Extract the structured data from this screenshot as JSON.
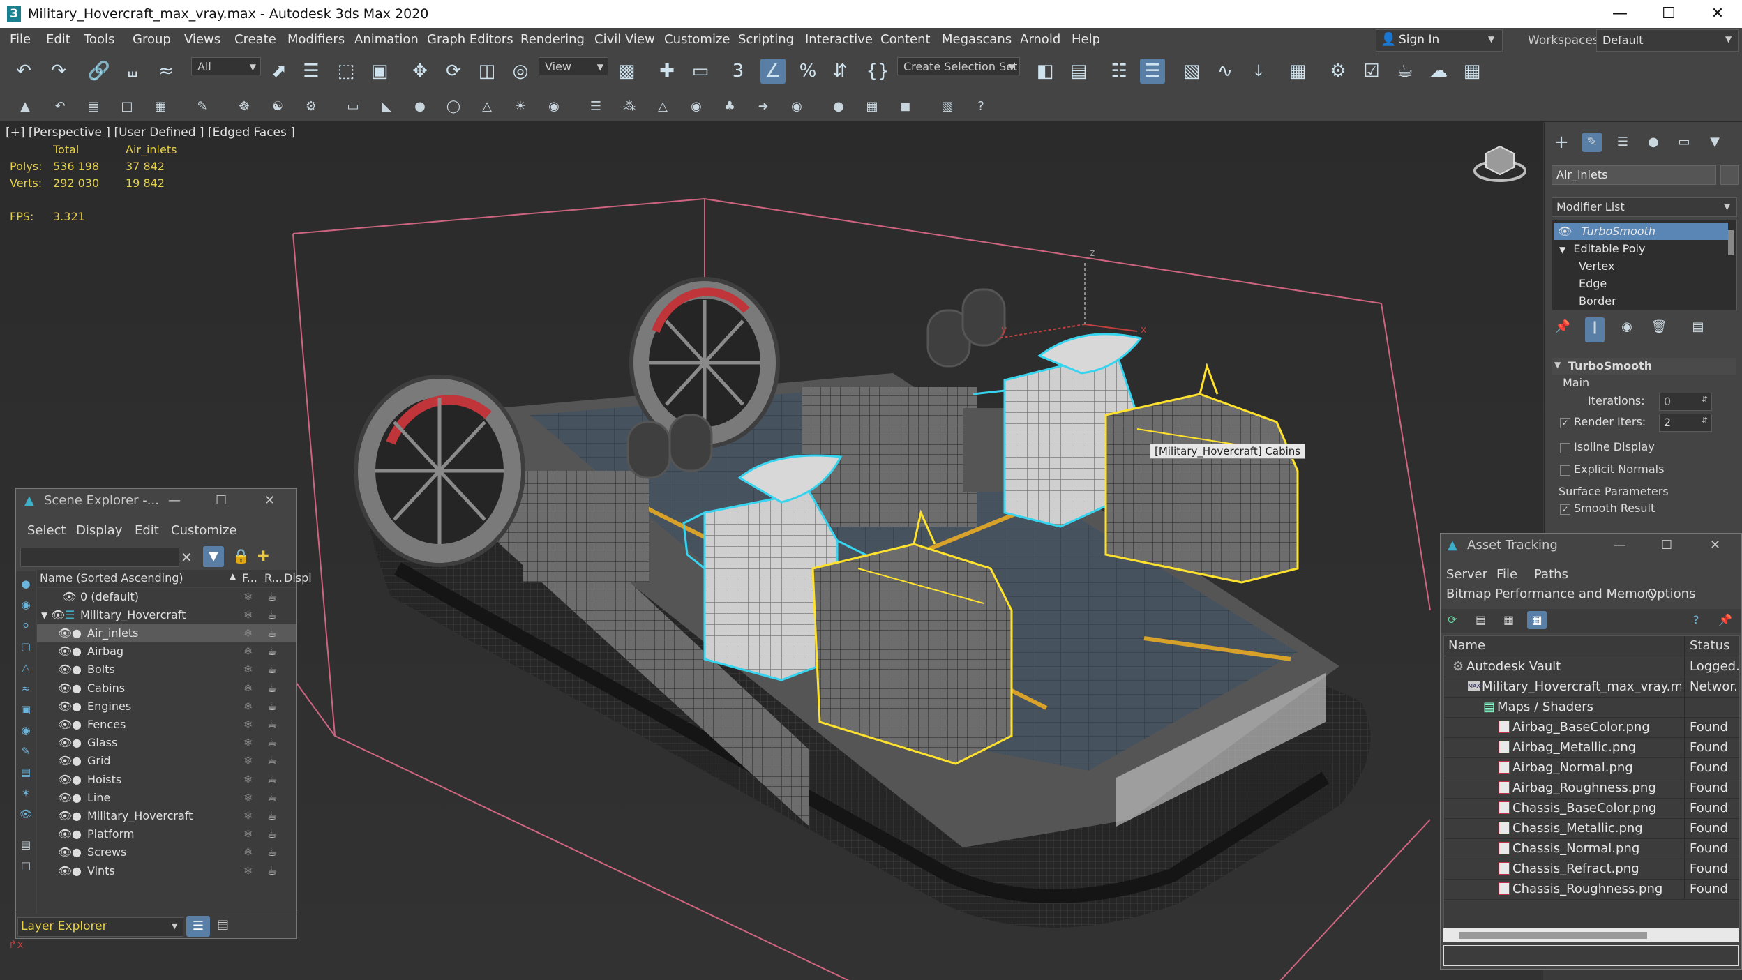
{
  "window": {
    "title": "Military_Hovercraft_max_vray.max - Autodesk 3ds Max 2020",
    "logo_glyph": "3",
    "minimize_glyph": "—",
    "maximize_glyph": "☐",
    "close_glyph": "✕"
  },
  "menu": [
    "File",
    "Edit",
    "Tools",
    "Group",
    "Views",
    "Create",
    "Modifiers",
    "Animation",
    "Graph Editors",
    "Rendering",
    "Civil View",
    "Customize",
    "Scripting",
    "Interactive",
    "Content",
    "Megascans",
    "Arnold",
    "Help"
  ],
  "account": {
    "sign_in": "Sign In",
    "workspaces_label": "Workspaces:",
    "workspace_value": "Default"
  },
  "toolbar": {
    "filter_value": "All",
    "refcoord_value": "View",
    "selection_set_placeholder": "Create Selection Set"
  },
  "viewport": {
    "label": "[+] [Perspective ] [User Defined ] [Edged Faces ]",
    "stats": {
      "header_total": "Total",
      "header_obj": "Air_inlets",
      "polys_label": "Polys:",
      "polys_total": "536 198",
      "polys_obj": "37 842",
      "verts_label": "Verts:",
      "verts_total": "292 030",
      "verts_obj": "19 842",
      "fps_label": "FPS:",
      "fps_value": "3.321"
    },
    "tooltip": "[Military_Hovercraft] Cabins",
    "axis_x": "x",
    "axis_y": "y",
    "axis_z": "z",
    "colors": {
      "select_cyan": "#37d4ef",
      "select_yellow": "#ffe22e",
      "bbox_pink": "#e06a8a"
    }
  },
  "command_panel": {
    "object_name": "Air_inlets",
    "modifier_list": "Modifier List",
    "stack": [
      "TurboSmooth",
      "Editable Poly",
      "Vertex",
      "Edge",
      "Border"
    ],
    "rollout_title": "TurboSmooth",
    "main_label": "Main",
    "iterations_label": "Iterations:",
    "iterations_value": "0",
    "render_iters_label": "Render Iters:",
    "render_iters_value": "2",
    "isoline_label": "Isoline Display",
    "explicit_label": "Explicit Normals",
    "surface_label": "Surface Parameters",
    "smooth_result_label": "Smooth Result"
  },
  "scene_explorer": {
    "title": "Scene Explorer -...",
    "menu": [
      "Select",
      "Display",
      "Edit",
      "Customize"
    ],
    "col_name": "Name (Sorted Ascending)",
    "col_f": "F...",
    "col_r": "R...",
    "col_disp": "Displ",
    "default_layer": "0 (default)",
    "root": "Military_Hovercraft",
    "items": [
      "Air_inlets",
      "Airbag",
      "Bolts",
      "Cabins",
      "Engines",
      "Fences",
      "Glass",
      "Grid",
      "Hoists",
      "Line",
      "Military_Hovercraft",
      "Platform",
      "Screws",
      "Vints"
    ],
    "footer": "Layer Explorer"
  },
  "asset_tracking": {
    "title": "Asset Tracking",
    "menu1": [
      "Server",
      "File",
      "Paths"
    ],
    "menu2": [
      "Bitmap Performance and Memory",
      "Options"
    ],
    "col_name": "Name",
    "col_status": "Status",
    "rows": [
      {
        "name": "Autodesk Vault",
        "status": "Logged...",
        "indent": 0
      },
      {
        "name": "Military_Hovercraft_max_vray.max",
        "status": "Networ...",
        "indent": 1
      },
      {
        "name": "Maps / Shaders",
        "status": "",
        "indent": 2
      },
      {
        "name": "Airbag_BaseColor.png",
        "status": "Found",
        "indent": 3
      },
      {
        "name": "Airbag_Metallic.png",
        "status": "Found",
        "indent": 3
      },
      {
        "name": "Airbag_Normal.png",
        "status": "Found",
        "indent": 3
      },
      {
        "name": "Airbag_Roughness.png",
        "status": "Found",
        "indent": 3
      },
      {
        "name": "Chassis_BaseColor.png",
        "status": "Found",
        "indent": 3
      },
      {
        "name": "Chassis_Metallic.png",
        "status": "Found",
        "indent": 3
      },
      {
        "name": "Chassis_Normal.png",
        "status": "Found",
        "indent": 3
      },
      {
        "name": "Chassis_Refract.png",
        "status": "Found",
        "indent": 3
      },
      {
        "name": "Chassis_Roughness.png",
        "status": "Found",
        "indent": 3
      }
    ]
  }
}
